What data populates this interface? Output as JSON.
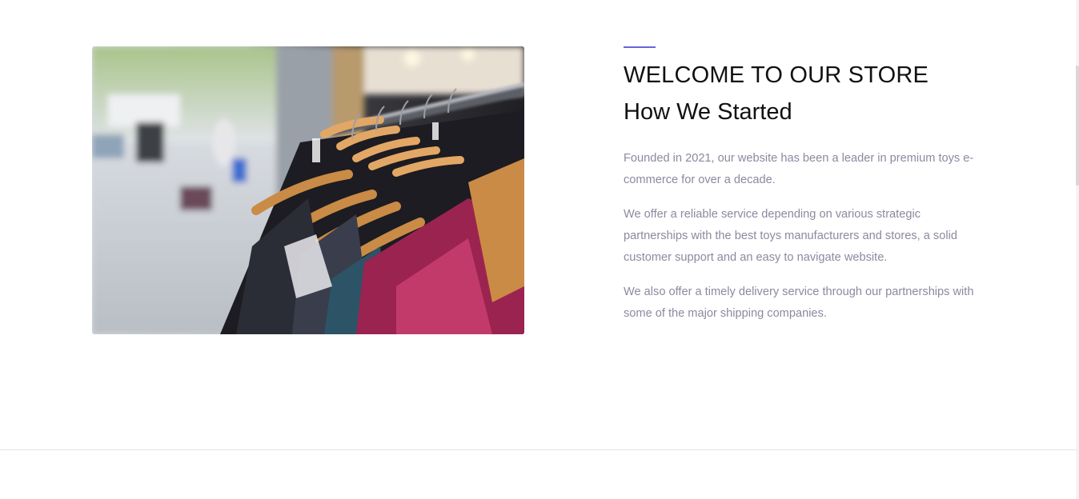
{
  "about": {
    "image_alt": "Clothes on hangers on a rack",
    "eyebrow_title": "WELCOME TO OUR STORE",
    "title": "How We Started",
    "paragraphs": [
      "Founded in 2021, our website has been a leader in premium toys e-commerce for over a decade.",
      "We offer a reliable service depending on various strategic partnerships with the best toys manufacturers and stores, a solid customer support and an easy to navigate website.",
      "We also offer a timely delivery service through our partnerships with some of the major shipping companies."
    ]
  },
  "colors": {
    "accent": "#6c63d6",
    "heading": "#111111",
    "body_text": "#8a8aa0"
  }
}
